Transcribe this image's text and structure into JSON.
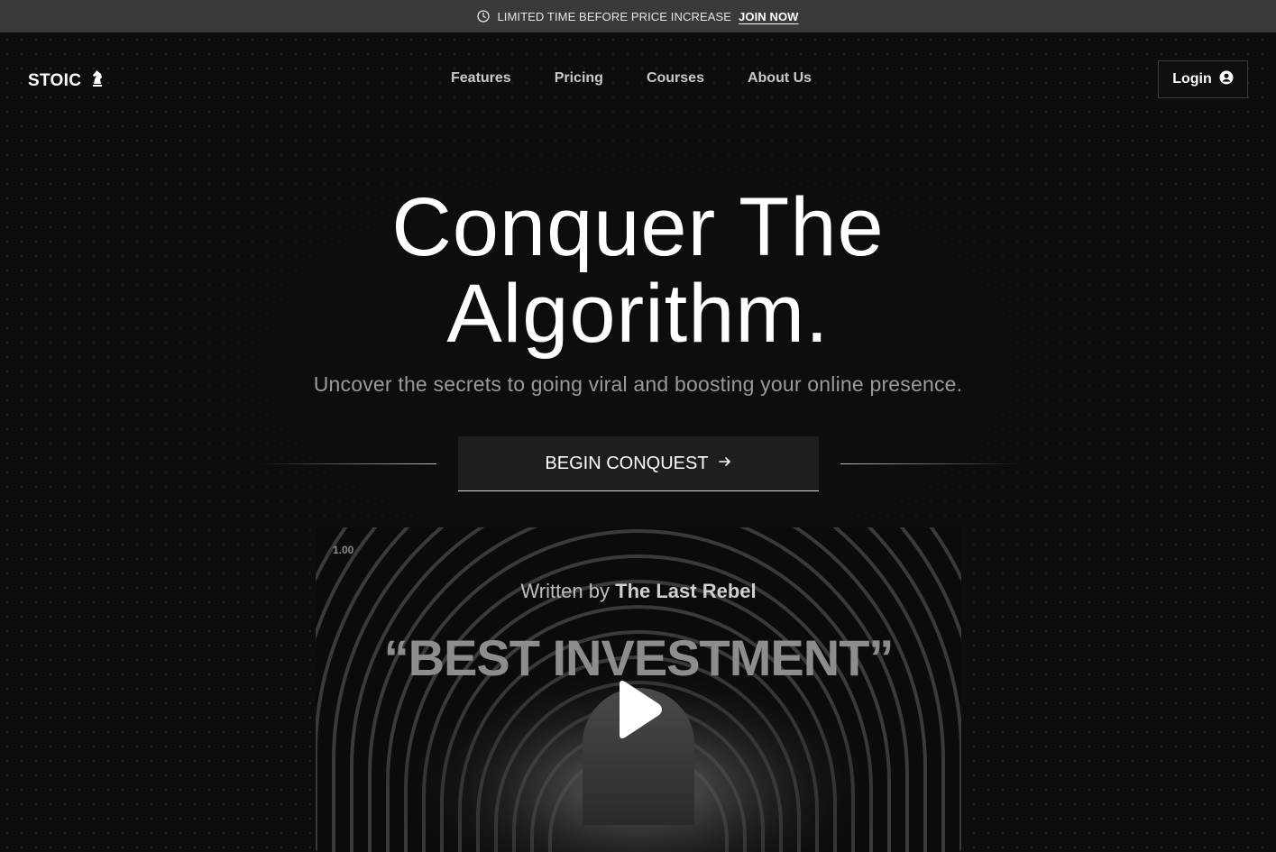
{
  "banner": {
    "icon": "clock-icon",
    "text": "LIMITED TIME BEFORE PRICE INCREASE",
    "link": "JOIN NOW"
  },
  "nav": {
    "brand": "STOIC",
    "brand_icon": "chess-knight-icon",
    "items": [
      "Features",
      "Pricing",
      "Courses",
      "About Us"
    ],
    "login_label": "Login",
    "login_icon": "user-circle-icon"
  },
  "hero": {
    "title_line1": "Conquer The",
    "title_line2": "Algorithm.",
    "subtitle": "Uncover the secrets to going viral and boosting your online presence.",
    "cta_label": "BEGIN CONQUEST",
    "cta_icon": "arrow-right-icon"
  },
  "video": {
    "speed": "1.00",
    "written_prefix": "Written by",
    "author": "The Last Rebel",
    "quote": "“BEST INVESTMENT”",
    "play_icon": "play-icon"
  },
  "colors": {
    "background": "#0d0d0d",
    "banner": "#3a3a3a",
    "muted_text": "#9a9a9a"
  }
}
